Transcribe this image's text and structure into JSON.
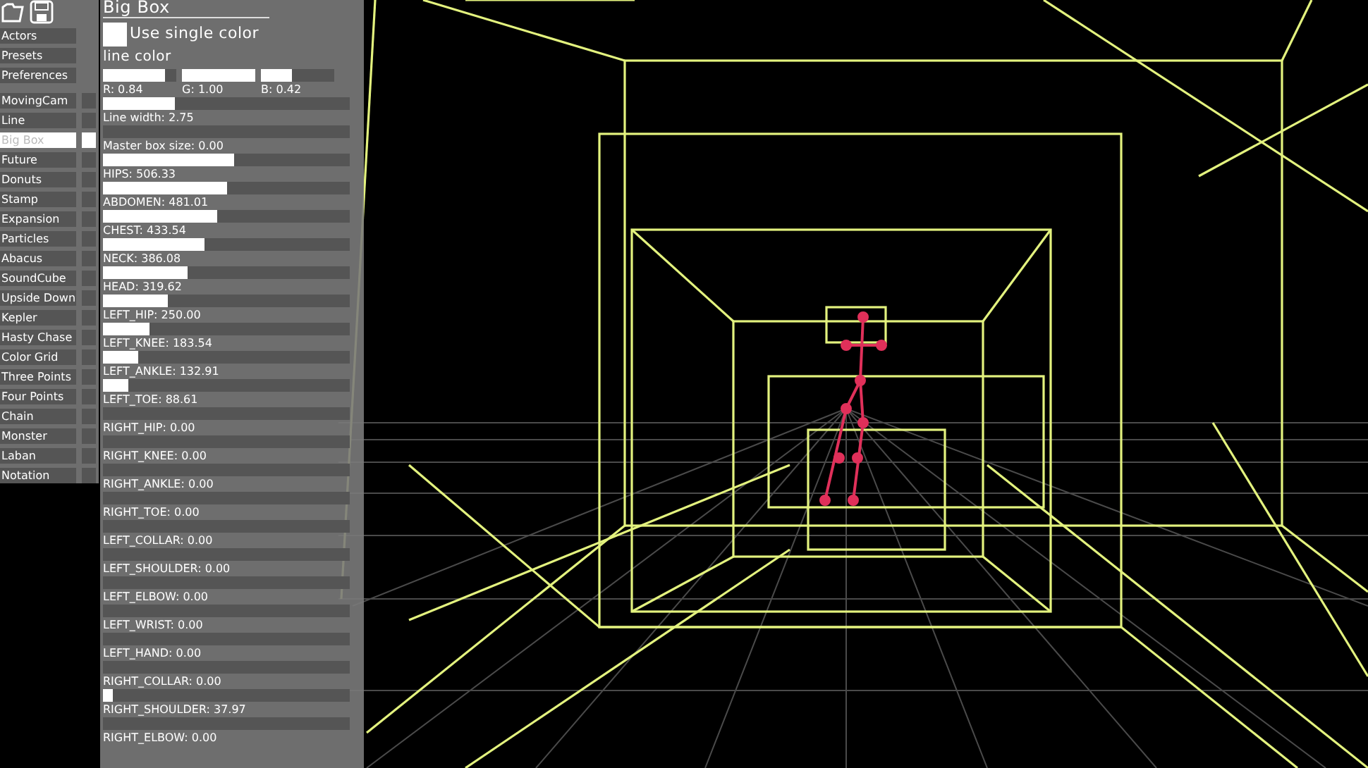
{
  "menu": {
    "top": [
      {
        "label": "Actors"
      },
      {
        "label": "Presets"
      },
      {
        "label": "Preferences"
      }
    ],
    "scenes": [
      {
        "label": "MovingCam",
        "selected": false,
        "on": false
      },
      {
        "label": "Line",
        "selected": false,
        "on": false
      },
      {
        "label": "Big Box",
        "selected": true,
        "on": true
      },
      {
        "label": "Future",
        "selected": false,
        "on": false
      },
      {
        "label": "Donuts",
        "selected": false,
        "on": false
      },
      {
        "label": "Stamp",
        "selected": false,
        "on": false
      },
      {
        "label": "Expansion",
        "selected": false,
        "on": false
      },
      {
        "label": "Particles",
        "selected": false,
        "on": false
      },
      {
        "label": "Abacus",
        "selected": false,
        "on": false
      },
      {
        "label": "SoundCube",
        "selected": false,
        "on": false
      },
      {
        "label": "Upside Down",
        "selected": false,
        "on": false
      },
      {
        "label": "Kepler",
        "selected": false,
        "on": false
      },
      {
        "label": "Hasty Chase",
        "selected": false,
        "on": false
      },
      {
        "label": "Color Grid",
        "selected": false,
        "on": false
      },
      {
        "label": "Three Points",
        "selected": false,
        "on": false
      },
      {
        "label": "Four Points",
        "selected": false,
        "on": false
      },
      {
        "label": "Chain",
        "selected": false,
        "on": false
      },
      {
        "label": "Monster",
        "selected": false,
        "on": false
      },
      {
        "label": "Laban",
        "selected": false,
        "on": false
      },
      {
        "label": "Notation",
        "selected": false,
        "on": false
      }
    ]
  },
  "panel": {
    "title": "Big Box",
    "single_color": {
      "label": "Use single color",
      "on": true
    },
    "color_label": "line color",
    "color_sliders": [
      {
        "label": "R: 0.84",
        "level": 0.84
      },
      {
        "label": "G: 1.00",
        "level": 1.0
      },
      {
        "label": "B: 0.42",
        "level": 0.42
      }
    ],
    "sliders": [
      {
        "label": "Line width: 2.75",
        "level": 0.29
      },
      {
        "label": "Master box size: 0.00",
        "level": 0
      },
      {
        "label": "HIPS: 506.33",
        "level": 0.53
      },
      {
        "label": "ABDOMEN: 481.01",
        "level": 0.5
      },
      {
        "label": "CHEST: 433.54",
        "level": 0.46
      },
      {
        "label": "NECK: 386.08",
        "level": 0.41
      },
      {
        "label": "HEAD: 319.62",
        "level": 0.34
      },
      {
        "label": "LEFT_HIP: 250.00",
        "level": 0.26
      },
      {
        "label": "LEFT_KNEE: 183.54",
        "level": 0.19
      },
      {
        "label": "LEFT_ANKLE: 132.91",
        "level": 0.14
      },
      {
        "label": "LEFT_TOE: 88.61",
        "level": 0.1
      },
      {
        "label": "RIGHT_HIP: 0.00",
        "level": 0
      },
      {
        "label": "RIGHT_KNEE: 0.00",
        "level": 0
      },
      {
        "label": "RIGHT_ANKLE: 0.00",
        "level": 0
      },
      {
        "label": "RIGHT_TOE: 0.00",
        "level": 0
      },
      {
        "label": "LEFT_COLLAR: 0.00",
        "level": 0
      },
      {
        "label": "LEFT_SHOULDER: 0.00",
        "level": 0
      },
      {
        "label": "LEFT_ELBOW: 0.00",
        "level": 0
      },
      {
        "label": "LEFT_WRIST: 0.00",
        "level": 0
      },
      {
        "label": "LEFT_HAND: 0.00",
        "level": 0
      },
      {
        "label": "RIGHT_COLLAR: 0.00",
        "level": 0
      },
      {
        "label": "RIGHT_SHOULDER: 37.97",
        "level": 0.04
      },
      {
        "label": "RIGHT_ELBOW: 0.00",
        "level": 0
      }
    ]
  }
}
